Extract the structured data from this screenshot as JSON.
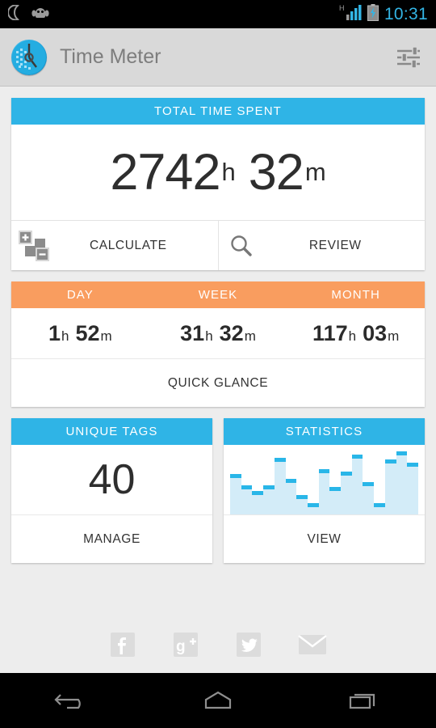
{
  "statusbar": {
    "icons": [
      "moon-icon",
      "android-head-icon",
      "signal-icon",
      "battery-charging-icon"
    ],
    "network_type": "H",
    "clock": "10:31",
    "clock_color": "#33b5e5"
  },
  "actionbar": {
    "app_icon": "time-meter-logo-icon",
    "title": "Time Meter",
    "settings_icon": "sliders-icon"
  },
  "theme": {
    "accent_blue": "#2fb4e6",
    "accent_orange": "#f99d5f",
    "chart_fill": "#d3ecf8",
    "chart_cap": "#29b6e8",
    "page_background": "#ededed"
  },
  "total_card": {
    "header": "TOTAL TIME SPENT",
    "hours": "2742",
    "hours_unit": "h",
    "minutes": "32",
    "minutes_unit": "m",
    "actions": [
      {
        "label": "CALCULATE",
        "icon": "calculate-blocks-icon"
      },
      {
        "label": "REVIEW",
        "icon": "search-icon"
      }
    ]
  },
  "period_card": {
    "columns": [
      "DAY",
      "WEEK",
      "MONTH"
    ],
    "values": [
      {
        "hours": "1",
        "hours_unit": "h",
        "minutes": "52",
        "minutes_unit": "m"
      },
      {
        "hours": "31",
        "hours_unit": "h",
        "minutes": "32",
        "minutes_unit": "m"
      },
      {
        "hours": "117",
        "hours_unit": "h",
        "minutes": "03",
        "minutes_unit": "m"
      }
    ],
    "action": "QUICK GLANCE"
  },
  "tags_card": {
    "header": "UNIQUE TAGS",
    "value": "40",
    "action": "MANAGE"
  },
  "statistics_card": {
    "header": "STATISTICS",
    "action": "VIEW"
  },
  "chart_data": {
    "type": "bar",
    "title": "STATISTICS",
    "categories": [
      "1",
      "2",
      "3",
      "4",
      "5",
      "6",
      "7",
      "8",
      "9",
      "10",
      "11",
      "12",
      "13",
      "14",
      "15"
    ],
    "values": [
      62,
      45,
      36,
      45,
      88,
      55,
      30,
      18,
      70,
      43,
      66,
      92,
      50,
      18,
      85,
      97,
      80
    ],
    "ylim": [
      0,
      100
    ],
    "grid": false,
    "xlabel": "",
    "ylabel": ""
  },
  "social": {
    "items": [
      {
        "icon": "facebook-icon",
        "label": "Facebook"
      },
      {
        "icon": "google-plus-icon",
        "label": "Google Plus"
      },
      {
        "icon": "twitter-icon",
        "label": "Twitter"
      },
      {
        "icon": "email-icon",
        "label": "Email"
      }
    ]
  },
  "navbar": {
    "buttons": [
      {
        "icon": "back-icon",
        "label": "Back"
      },
      {
        "icon": "home-icon",
        "label": "Home"
      },
      {
        "icon": "recents-icon",
        "label": "Recents"
      }
    ]
  }
}
